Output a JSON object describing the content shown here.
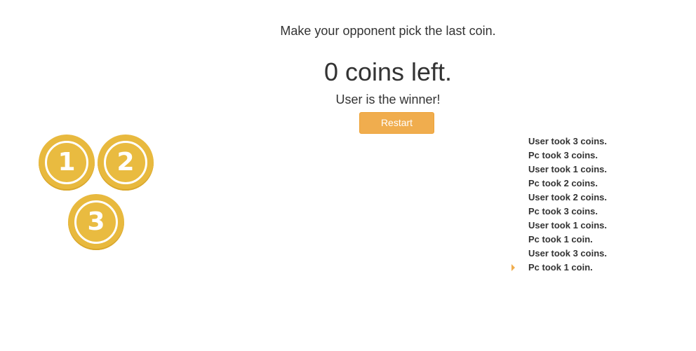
{
  "game": {
    "instructions": "Make your opponent pick the last coin.",
    "coins_left_text": "0 coins left.",
    "winner_text": "User is the winner!",
    "restart_label": "Restart"
  },
  "coins": [
    {
      "label": "1"
    },
    {
      "label": "2"
    },
    {
      "label": "3"
    }
  ],
  "log": [
    "User took 3 coins.",
    "Pc took 3 coins.",
    "User took 1 coins.",
    "Pc took 2 coins.",
    "User took 2 coins.",
    "Pc took 3 coins.",
    "User took 1 coins.",
    "Pc took 1 coin.",
    "User took 3 coins.",
    "Pc took 1 coin."
  ],
  "colors": {
    "coin": "#e8b93e",
    "accent": "#f0ad4e",
    "text": "#333333"
  },
  "icons": {
    "current_move_marker": "caret-right-icon"
  }
}
